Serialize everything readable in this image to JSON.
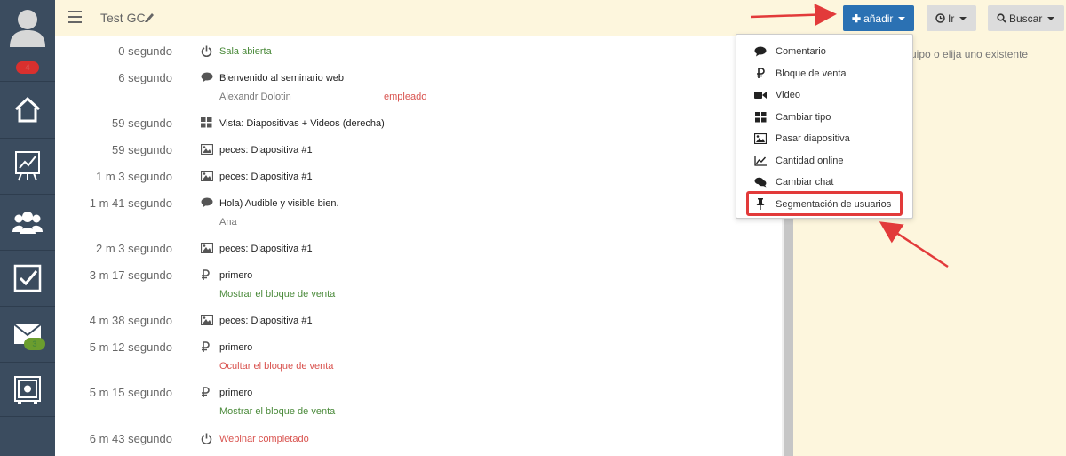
{
  "sidebar": {
    "notifications_badge": "4",
    "mail_badge": "3",
    "items": [
      {
        "icon": "home-icon"
      },
      {
        "icon": "chart-board-icon"
      },
      {
        "icon": "users-icon"
      },
      {
        "icon": "checkbox-icon"
      },
      {
        "icon": "mail-icon"
      },
      {
        "icon": "safe-icon"
      }
    ]
  },
  "header": {
    "title": "Test GC",
    "add_label": "añadir",
    "go_label": "Ir",
    "search_label": "Buscar"
  },
  "right_panel": {
    "text": "uipo o elija uno existente"
  },
  "feed": [
    {
      "time": "0 segundo",
      "icon": "power-icon",
      "text": "Sala abierta",
      "style": "green"
    },
    {
      "time": "6 segundo",
      "icon": "comment-icon",
      "text": "Bienvenido al seminario web",
      "sub": "Alexandr Dolotin",
      "role": "empleado"
    },
    {
      "time": "59 segundo",
      "icon": "grid-icon",
      "text": "Vista: Diapositivas + Videos (derecha)"
    },
    {
      "time": "59 segundo",
      "icon": "image-icon",
      "text": "peces: Diapositiva #1"
    },
    {
      "time": "1 m 3 segundo",
      "icon": "image-icon",
      "text": "peces: Diapositiva #1"
    },
    {
      "time": "1 m 41 segundo",
      "icon": "comment-icon",
      "text": "Hola) Audible y visible bien.",
      "sub": "Ana"
    },
    {
      "time": "2 m 3 segundo",
      "icon": "image-icon",
      "text": "peces: Diapositiva #1"
    },
    {
      "time": "3 m 17 segundo",
      "icon": "ruble-icon",
      "text": "primero",
      "sub": "Mostrar el bloque de venta",
      "sub_style": "green"
    },
    {
      "time": "4 m 38 segundo",
      "icon": "image-icon",
      "text": "peces: Diapositiva #1"
    },
    {
      "time": "5 m 12 segundo",
      "icon": "ruble-icon",
      "text": "primero",
      "sub": "Ocultar el bloque de venta",
      "sub_style": "red"
    },
    {
      "time": "5 m 15 segundo",
      "icon": "ruble-icon",
      "text": "primero",
      "sub": "Mostrar el bloque de venta",
      "sub_style": "green"
    },
    {
      "time": "6 m 43 segundo",
      "icon": "power-icon",
      "text": "Webinar completado",
      "style": "red"
    }
  ],
  "add_menu": [
    {
      "icon": "comment-icon",
      "label": "Comentario"
    },
    {
      "icon": "ruble-icon",
      "label": "Bloque de venta"
    },
    {
      "icon": "video-icon",
      "label": "Video"
    },
    {
      "icon": "grid-icon",
      "label": "Cambiar tipo"
    },
    {
      "icon": "image-icon",
      "label": "Pasar diapositiva"
    },
    {
      "icon": "line-chart-icon",
      "label": "Cantidad online"
    },
    {
      "icon": "comments-icon",
      "label": "Cambiar chat"
    },
    {
      "icon": "pin-icon",
      "label": "Segmentación de usuarios"
    }
  ],
  "colors": {
    "sidebar_bg": "#3b4c5f",
    "topbar_bg": "#fdf6dd",
    "primary": "#2b71b3",
    "annotation": "#e23a3a"
  }
}
